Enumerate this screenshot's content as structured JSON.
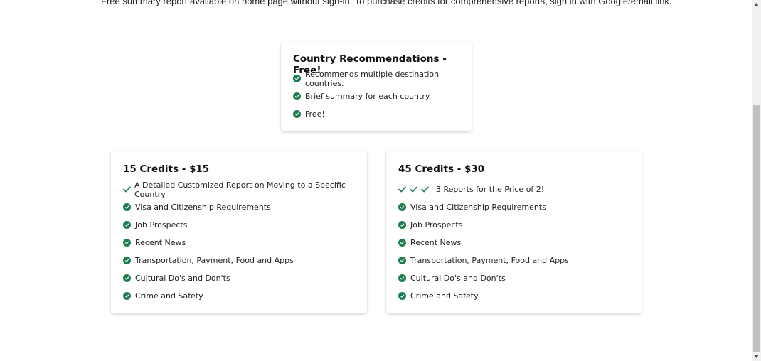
{
  "intro_text": "Free summary report available on home page without sign-in. To purchase credits for comprehensive reports, sign in with Google/email link.",
  "colors": {
    "check": "#1e7d4f",
    "card_bg": "#ffffff"
  },
  "plans": {
    "free": {
      "title": "Country Recommendations - Free!",
      "features": [
        "Recommends multiple destination countries.",
        "Brief summary for each country.",
        "Free!"
      ]
    },
    "credits15": {
      "title": "15 Credits - $15",
      "features": [
        "A Detailed Customized Report on Moving to a Specific Country",
        "Visa and Citizenship Requirements",
        "Job Prospects",
        "Recent News",
        "Transportation, Payment, Food and Apps",
        "Cultural Do's and Don'ts",
        "Crime and Safety"
      ]
    },
    "credits45": {
      "title": "45 Credits - $30",
      "features": [
        "3 Reports for the Price of 2!",
        "Visa and Citizenship Requirements",
        "Job Prospects",
        "Recent News",
        "Transportation, Payment, Food and Apps",
        "Cultural Do's and Don'ts",
        "Crime and Safety"
      ]
    }
  }
}
